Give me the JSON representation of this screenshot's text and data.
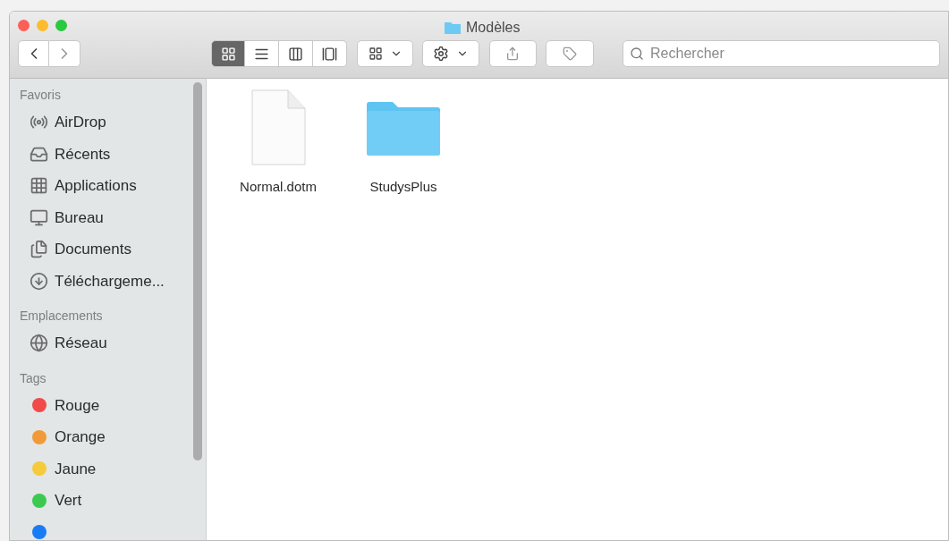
{
  "window": {
    "title": "Modèles"
  },
  "view_modes": [
    {
      "kind": "icons",
      "selected": true
    },
    {
      "kind": "list",
      "selected": false
    },
    {
      "kind": "columns",
      "selected": false
    },
    {
      "kind": "gallery",
      "selected": false
    }
  ],
  "search": {
    "placeholder": "Rechercher"
  },
  "sidebar": {
    "sections": [
      {
        "title": "Favoris",
        "items": [
          {
            "kind": "airdrop",
            "label": "AirDrop"
          },
          {
            "kind": "recents",
            "label": "Récents"
          },
          {
            "kind": "applications",
            "label": "Applications"
          },
          {
            "kind": "desktop",
            "label": "Bureau"
          },
          {
            "kind": "documents",
            "label": "Documents"
          },
          {
            "kind": "downloads",
            "label": "Téléchargeme..."
          }
        ]
      },
      {
        "title": "Emplacements",
        "items": [
          {
            "kind": "network",
            "label": "Réseau"
          }
        ]
      },
      {
        "title": "Tags",
        "items": [
          {
            "kind": "tag",
            "label": "Rouge",
            "color": "#f04a4a"
          },
          {
            "kind": "tag",
            "label": "Orange",
            "color": "#f29a3a"
          },
          {
            "kind": "tag",
            "label": "Jaune",
            "color": "#f5cb3c"
          },
          {
            "kind": "tag",
            "label": "Vert",
            "color": "#3cc94f"
          },
          {
            "kind": "tag",
            "color": "#1a7cf5"
          }
        ]
      }
    ]
  },
  "files": [
    {
      "kind": "document",
      "name": "Normal.dotm"
    },
    {
      "kind": "folder",
      "name": "StudysPlus"
    }
  ]
}
